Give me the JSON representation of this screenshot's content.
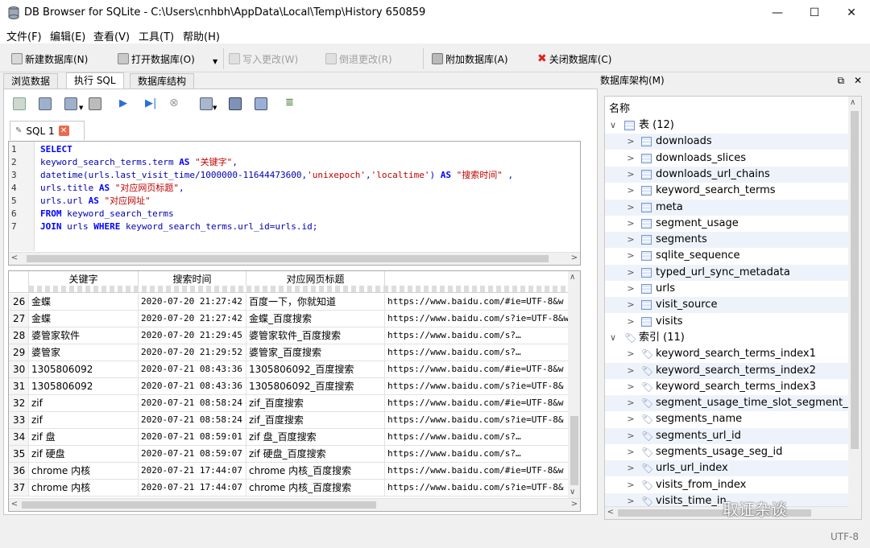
{
  "window": {
    "title": "DB Browser for SQLite - C:\\Users\\cnhbh\\AppData\\Local\\Temp\\History 650859",
    "controls": {
      "minimize": "—",
      "maximize": "☐",
      "close": "✕"
    }
  },
  "menu": [
    "文件(F)",
    "编辑(E)",
    "查看(V)",
    "工具(T)",
    "帮助(H)"
  ],
  "toolbar": {
    "new_db": "新建数据库(N)",
    "open_db": "打开数据库(O)",
    "write_changes": "写入更改(W)",
    "revert_changes": "倒退更改(R)",
    "attach_db": "附加数据库(A)",
    "close_db": "关闭数据库(C)"
  },
  "tabs": [
    "浏览数据",
    "执行 SQL",
    "数据库结构"
  ],
  "active_tab": "执行 SQL",
  "sql_tab": {
    "label": "SQL 1",
    "close": "✕"
  },
  "editor": {
    "line_numbers": [
      "1",
      "2",
      "3",
      "4",
      "5",
      "6",
      "7"
    ],
    "lines": [
      "SELECT",
      "keyword_search_terms.term AS \"关键字\",",
      "datetime(urls.last_visit_time/1000000-11644473600,'unixepoch','localtime') AS \"搜索时间\" ,",
      "urls.title AS \"对应网页标题\",",
      "urls.url AS \"对应网址\"",
      "FROM keyword_search_terms",
      "JOIN urls WHERE keyword_search_terms.url_id=urls.id;"
    ]
  },
  "results": {
    "columns": [
      "关键字",
      "搜索时间",
      "对应网页标题",
      ""
    ],
    "rows": [
      {
        "n": "26",
        "kw": "金蝶",
        "time": "2020-07-20 21:27:42",
        "title": "百度一下，你就知道",
        "url": "https://www.baidu.com/#ie=UTF-8&w"
      },
      {
        "n": "27",
        "kw": "金蝶",
        "time": "2020-07-20 21:27:42",
        "title": "金蝶_百度搜索",
        "url": "https://www.baidu.com/s?ie=UTF-8&w"
      },
      {
        "n": "28",
        "kw": "婆管家软件",
        "time": "2020-07-20 21:29:45",
        "title": "婆管家软件_百度搜索",
        "url": "https://www.baidu.com/s?…"
      },
      {
        "n": "29",
        "kw": "婆管家",
        "time": "2020-07-20 21:29:52",
        "title": "婆管家_百度搜索",
        "url": "https://www.baidu.com/s?…"
      },
      {
        "n": "30",
        "kw": "1305806092",
        "time": "2020-07-21 08:43:36",
        "title": "1305806092_百度搜索",
        "url": "https://www.baidu.com/#ie=UTF-8&w"
      },
      {
        "n": "31",
        "kw": "1305806092",
        "time": "2020-07-21 08:43:36",
        "title": "1305806092_百度搜索",
        "url": "https://www.baidu.com/s?ie=UTF-8&"
      },
      {
        "n": "32",
        "kw": "zif",
        "time": "2020-07-21 08:58:24",
        "title": "zif_百度搜索",
        "url": "https://www.baidu.com/#ie=UTF-8&w"
      },
      {
        "n": "33",
        "kw": "zif",
        "time": "2020-07-21 08:58:24",
        "title": "zif_百度搜索",
        "url": "https://www.baidu.com/s?ie=UTF-8&"
      },
      {
        "n": "34",
        "kw": "zif 盘",
        "time": "2020-07-21 08:59:01",
        "title": "zif 盘_百度搜索",
        "url": "https://www.baidu.com/s?…"
      },
      {
        "n": "35",
        "kw": "zif 硬盘",
        "time": "2020-07-21 08:59:07",
        "title": "zif 硬盘_百度搜索",
        "url": "https://www.baidu.com/s?…"
      },
      {
        "n": "36",
        "kw": "chrome 内核",
        "time": "2020-07-21 17:44:07",
        "title": "chrome 内核_百度搜索",
        "url": "https://www.baidu.com/#ie=UTF-8&w"
      },
      {
        "n": "37",
        "kw": "chrome 内核",
        "time": "2020-07-21 17:44:07",
        "title": "chrome 内核_百度搜索",
        "url": "https://www.baidu.com/s?ie=UTF-8&"
      }
    ]
  },
  "schema_dock": {
    "title": "数据库架构(M)",
    "header": "名称",
    "tables_label": "表 (12)",
    "tables": [
      "downloads",
      "downloads_slices",
      "downloads_url_chains",
      "keyword_search_terms",
      "meta",
      "segment_usage",
      "segments",
      "sqlite_sequence",
      "typed_url_sync_metadata",
      "urls",
      "visit_source",
      "visits"
    ],
    "indexes_label": "索引 (11)",
    "indexes": [
      "keyword_search_terms_index1",
      "keyword_search_terms_index2",
      "keyword_search_terms_index3",
      "segment_usage_time_slot_segment_id",
      "segments_name",
      "segments_url_id",
      "segments_usage_seg_id",
      "urls_url_index",
      "visits_from_index",
      "visits_time_in"
    ]
  },
  "status": {
    "encoding": "UTF-8"
  },
  "watermark": "取证杂谈",
  "colors": {
    "keyword": "#0000ff",
    "identifier": "#0000b0",
    "string": "#c00000",
    "close_tab": "#e86b50"
  }
}
